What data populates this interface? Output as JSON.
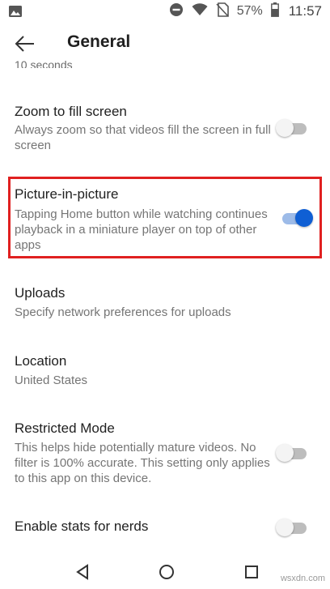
{
  "status_bar": {
    "battery_percent": "57%",
    "time": "11:57",
    "icons": [
      "image-icon",
      "do-not-disturb-icon",
      "wifi-icon",
      "no-sim-icon",
      "battery-icon"
    ]
  },
  "app_bar": {
    "back_icon": "arrow-left-icon",
    "title": "General"
  },
  "cut_off_text": "10 seconds",
  "settings": [
    {
      "title": "Zoom to fill screen",
      "description": "Always zoom so that videos fill the screen in full screen",
      "toggle": "off"
    },
    {
      "title": "Picture-in-picture",
      "description": "Tapping Home button while watching continues playback in a miniature player on top of other apps",
      "toggle": "on",
      "highlighted": true
    },
    {
      "title": "Uploads",
      "description": "Specify network preferences for uploads"
    },
    {
      "title": "Location",
      "description": "United States"
    },
    {
      "title": "Restricted Mode",
      "description": "This helps hide potentially mature videos. No filter is 100% accurate. This setting only applies to this app on this device.",
      "toggle": "off"
    },
    {
      "title": "Enable stats for nerds",
      "toggle": "off"
    }
  ],
  "colors": {
    "toggle_on": "#0f5fd4",
    "highlight_border": "#e02020"
  },
  "nav_bar": {
    "icons": [
      "back-triangle-icon",
      "home-circle-icon",
      "recents-square-icon"
    ]
  },
  "watermark": "wsxdn.com"
}
